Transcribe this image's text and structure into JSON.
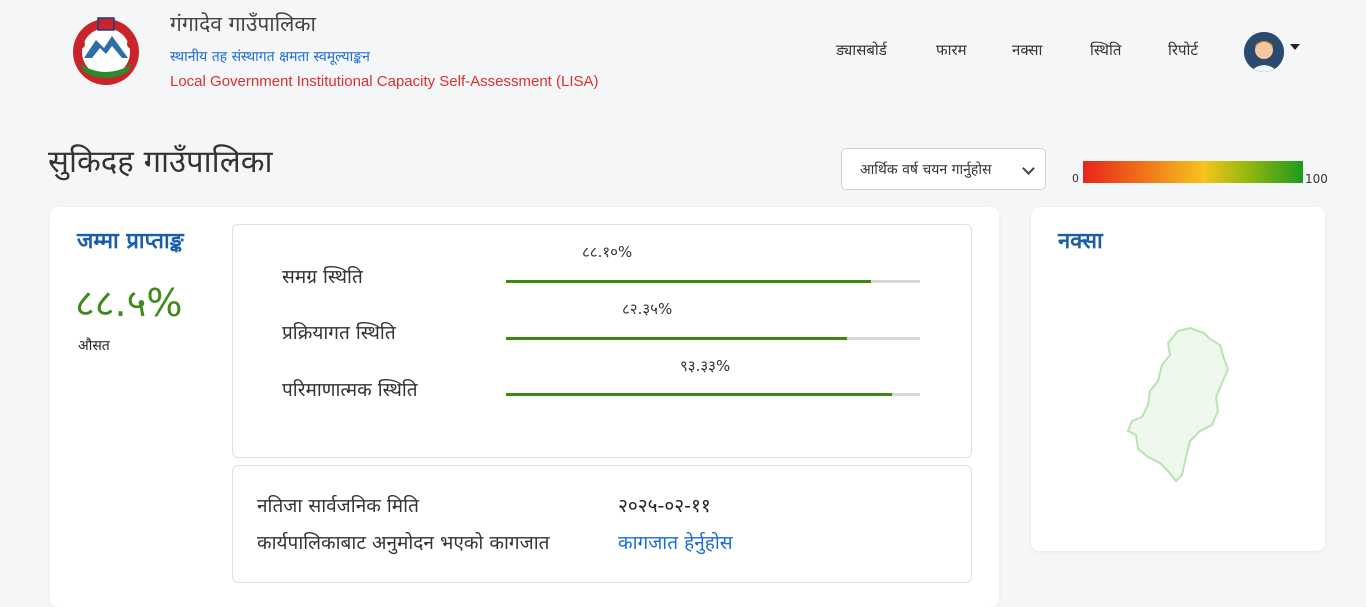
{
  "header": {
    "title": "गंगादेव गाउँपालिका",
    "subtitle": "स्थानीय तह संस्थागत क्षमता स्वमूल्याङ्कन",
    "subtitle_en": "Local Government Institutional Capacity Self-Assessment (LISA)",
    "nav": [
      "ड्यासबोर्ड",
      "फारम",
      "नक्सा",
      "स्थिति",
      "रिपोर्ट"
    ]
  },
  "page": {
    "title": "सुकिदह गाउँपालिका",
    "fiscal_year_select": "आर्थिक वर्ष चयन गार्नुहोस",
    "scale": {
      "min": "0",
      "max": "100"
    }
  },
  "score": {
    "title": "जम्मा प्राप्ताङ्क",
    "value": "८८.५%",
    "label": "औसत"
  },
  "status": [
    {
      "label": "समग्र स्थिति",
      "percent_text": "८८.१०%",
      "percent": 88.1
    },
    {
      "label": "प्रक्रियागत स्थिति",
      "percent_text": "८२.३५%",
      "percent": 82.35
    },
    {
      "label": "परिमाणात्मक स्थिति",
      "percent_text": "९३.३३%",
      "percent": 93.33
    }
  ],
  "results": {
    "publish_label": "नतिजा सार्वजनिक मिति",
    "publish_date": "२०२५-०२-११",
    "doc_label": "कार्यपालिकाबाट अनुमोदन भएको कागजात",
    "doc_link": "कागजात हेर्नुहोस"
  },
  "map": {
    "title": "नक्सा"
  },
  "colors": {
    "accent": "#1a5ea8",
    "score": "#3e8a1a",
    "progress": "#3a8a12",
    "link": "#1a6bd6"
  }
}
